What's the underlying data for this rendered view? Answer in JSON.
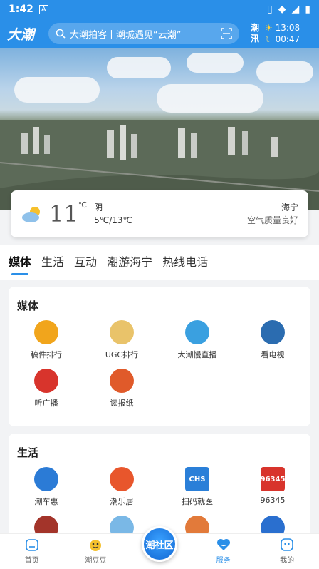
{
  "status": {
    "time": "1:42",
    "indicator": "A"
  },
  "header": {
    "logo": "大潮",
    "search_text": "大潮拍客丨潮城遇见“云潮”",
    "tide": {
      "label_top": "潮",
      "label_bottom": "汛",
      "time1": "13:08",
      "time2": "00:47"
    }
  },
  "weather": {
    "temp": "11",
    "unit": "℃",
    "condition": "阴",
    "range": "5℃/13℃",
    "city": "海宁",
    "air": "空气质量良好"
  },
  "tabs": [
    "媒体",
    "生活",
    "互动",
    "潮游海宁",
    "热线电话"
  ],
  "media": {
    "title": "媒体",
    "items": [
      {
        "label": "稿件排行",
        "icon": "trophy-icon",
        "color": "#f1a51c"
      },
      {
        "label": "UGC排行",
        "icon": "podium-icon",
        "color": "#e9c36a"
      },
      {
        "label": "大潮慢直播",
        "icon": "wave-icon",
        "color": "#3aa0e0"
      },
      {
        "label": "看电视",
        "icon": "tv-logo-icon",
        "color": "#2b6cb0"
      },
      {
        "label": "听广播",
        "icon": "radio-96-icon",
        "color": "#d8342c"
      },
      {
        "label": "读报纸",
        "icon": "newspaper-icon",
        "color": "#e05a2a"
      }
    ]
  },
  "life": {
    "title": "生活",
    "items": [
      {
        "label": "潮车惠",
        "icon": "car-icon",
        "color": "#2b7bd6"
      },
      {
        "label": "潮乐居",
        "icon": "house-icon",
        "color": "#e8562c"
      },
      {
        "label": "扫码就医",
        "icon": "chs-icon",
        "color": "#2a7fd8",
        "badge": "CHS"
      },
      {
        "label": "96345",
        "icon": "hotline-icon",
        "color": "#d8342c",
        "badge": "96345"
      },
      {
        "label": "",
        "icon": "scale-icon",
        "color": "#a3342a"
      },
      {
        "label": "",
        "icon": "document-icon",
        "color": "#7ab8e6"
      },
      {
        "label": "",
        "icon": "toolbox-icon",
        "color": "#e27a3a"
      },
      {
        "label": "",
        "icon": "restroom-icon",
        "color": "#2a6fcf"
      }
    ]
  },
  "bottom_nav": [
    {
      "label": "首页",
      "icon": "home-icon"
    },
    {
      "label": "潮豆豆",
      "icon": "mascot-icon"
    },
    {
      "label": "潮社区",
      "icon": "community-icon"
    },
    {
      "label": "服务",
      "icon": "heart-icon"
    },
    {
      "label": "我的",
      "icon": "profile-icon"
    }
  ]
}
